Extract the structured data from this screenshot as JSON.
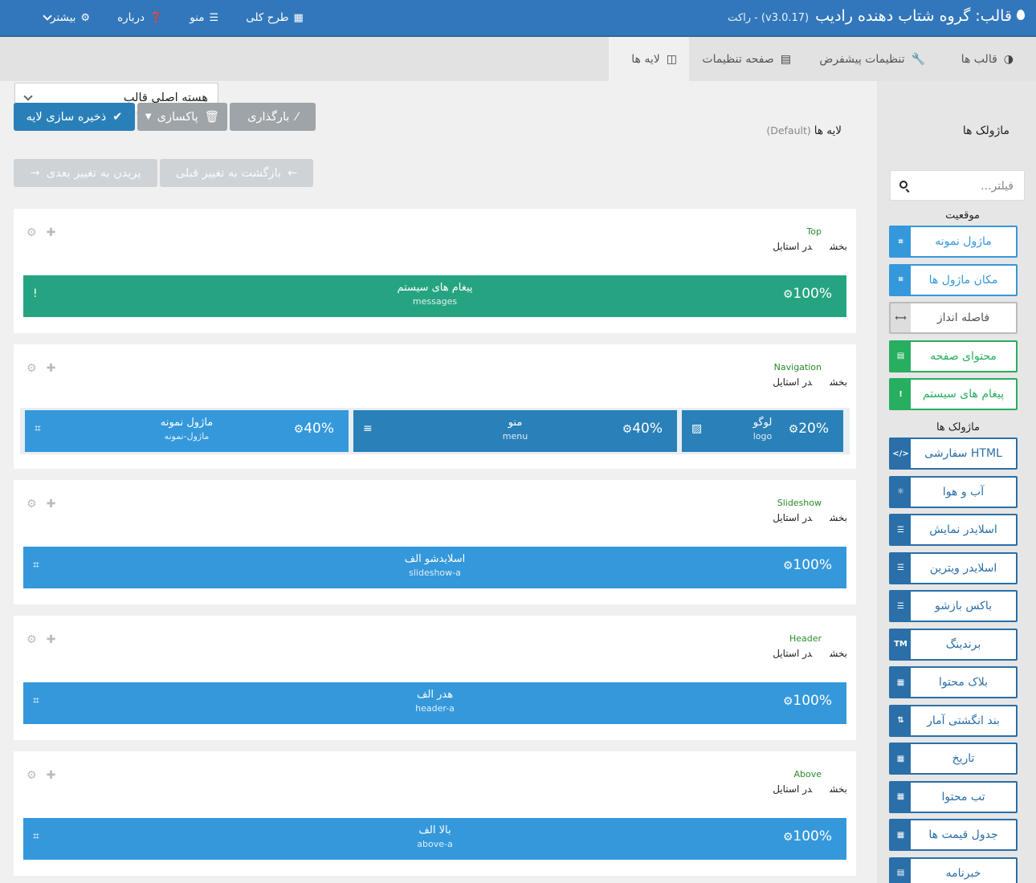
{
  "header": {
    "title": "قالب: گروه شتاب دهنده رادیب",
    "version": "(v3.0.17) - راکت",
    "nav": [
      {
        "label": "بیشتر",
        "icon": "gear-icon"
      },
      {
        "label": "درباره",
        "icon": "question-icon"
      },
      {
        "label": "منو",
        "icon": "menu-icon"
      },
      {
        "label": "طرح کلی",
        "icon": "grid-icon"
      }
    ]
  },
  "tabs": [
    {
      "label": "قالب ها",
      "icon": "contrast-icon"
    },
    {
      "label": "تنظیمات پیشفرض",
      "icon": "wrench-icon"
    },
    {
      "label": "صفحه تنظیمات",
      "icon": "list-icon"
    },
    {
      "label": "لایه ها",
      "icon": "columns-icon"
    }
  ],
  "outline_select": {
    "value": "هسته اصلی قالب"
  },
  "toolbar": {
    "save": "ذخیره سازی لایه",
    "clear": "پاکسازی",
    "load": "بارگذاری",
    "undo": "بازگشت به تغییر قبلی",
    "redo": "پریدن به تغییر بعدی"
  },
  "layers_title": {
    "label": "لایه ها",
    "default": "(Default)"
  },
  "sidebar": {
    "title": "ماژولک ها",
    "filter_placeholder": "فیلتر...",
    "position_label": "موقعیت",
    "particles_label": "ماژولک ها",
    "position_items": [
      {
        "label": "ماژول نمونه",
        "icon": "module-icon",
        "style": "blue"
      },
      {
        "label": "مکان ماژول ها",
        "icon": "position-icon",
        "style": "blue"
      },
      {
        "label": "فاصله انداز",
        "icon": "spacer-icon",
        "style": "gray"
      },
      {
        "label": "محتوای صفحه",
        "icon": "document-icon",
        "style": "green"
      },
      {
        "label": "پیغام های سیستم",
        "icon": "alert-icon",
        "style": "green"
      }
    ],
    "particle_items": [
      {
        "label": "HTML سفارشی",
        "icon": "code-icon"
      },
      {
        "label": "آب و هوا",
        "icon": "sun-icon"
      },
      {
        "label": "اسلایدر نمایش",
        "icon": "sliders-icon"
      },
      {
        "label": "اسلایدر ویترین",
        "icon": "sliders-icon"
      },
      {
        "label": "باکس بازشو",
        "icon": "list-icon"
      },
      {
        "label": "برندینگ",
        "icon": "tm-icon"
      },
      {
        "label": "بلاک محتوا",
        "icon": "blocks-icon"
      },
      {
        "label": "بند انگشتی آمار",
        "icon": "sort-icon"
      },
      {
        "label": "تاریخ",
        "icon": "calendar-icon"
      },
      {
        "label": "تب محتوا",
        "icon": "table-icon"
      },
      {
        "label": "جدول قیمت ها",
        "icon": "table-icon"
      },
      {
        "label": "خبرنامه",
        "icon": "document-icon"
      }
    ]
  },
  "section_meta": {
    "section": "بخش",
    "style": "در استایل"
  },
  "sections": [
    {
      "name": "Top",
      "blocks": [
        {
          "title": "پیغام های سیستم",
          "sub": "messages",
          "pct": "100%",
          "color": "#26a481",
          "icon": "alert-icon",
          "flex": 100
        }
      ]
    },
    {
      "name": "Navigation",
      "blocks": [
        {
          "title": "لوگو",
          "sub": "logo",
          "pct": "20%",
          "color": "#2a80b9",
          "icon": "image-icon",
          "flex": 20
        },
        {
          "title": "منو",
          "sub": "menu",
          "pct": "40%",
          "color": "#2a80b9",
          "icon": "menu-icon",
          "flex": 40
        },
        {
          "title": "ماژول نمونه",
          "sub": "ماژول-نمونه",
          "pct": "40%",
          "color": "#3498db",
          "icon": "module-icon",
          "flex": 40
        }
      ]
    },
    {
      "name": "Slideshow",
      "blocks": [
        {
          "title": "اسلایدشو الف",
          "sub": "slideshow-a",
          "pct": "100%",
          "color": "#3498db",
          "icon": "position-icon",
          "flex": 100
        }
      ]
    },
    {
      "name": "Header",
      "blocks": [
        {
          "title": "هدر الف",
          "sub": "header-a",
          "pct": "100%",
          "color": "#3498db",
          "icon": "position-icon",
          "flex": 100
        }
      ]
    },
    {
      "name": "Above",
      "blocks": [
        {
          "title": "بالا الف",
          "sub": "above-a",
          "pct": "100%",
          "color": "#3498db",
          "icon": "position-icon",
          "flex": 100
        }
      ]
    }
  ]
}
